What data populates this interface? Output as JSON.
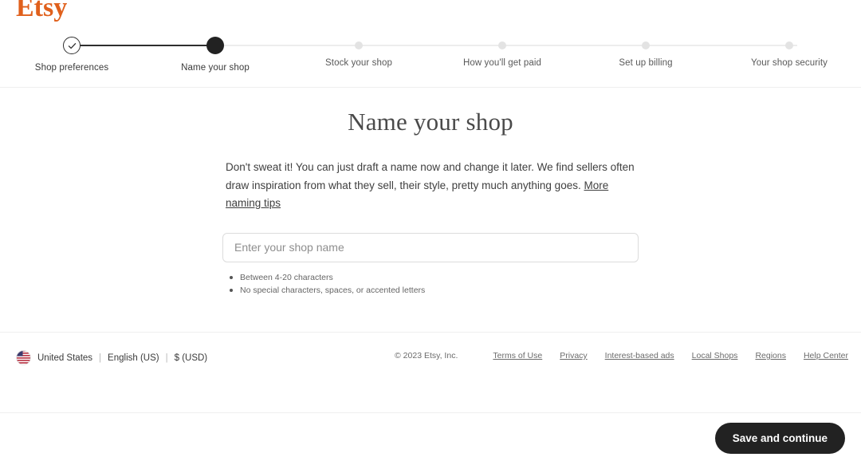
{
  "brand": {
    "logo_text": "Etsy",
    "logo_color": "#e0601c"
  },
  "stepper": {
    "steps": [
      {
        "label": "Shop preferences",
        "state": "completed",
        "icon": "check-icon"
      },
      {
        "label": "Name your shop",
        "state": "active",
        "icon": "filled-dot-icon"
      },
      {
        "label": "Stock your shop",
        "state": "upcoming",
        "icon": "dot-icon"
      },
      {
        "label": "How you'll get paid",
        "state": "upcoming",
        "icon": "dot-icon"
      },
      {
        "label": "Set up billing",
        "state": "upcoming",
        "icon": "dot-icon"
      },
      {
        "label": "Your shop security",
        "state": "upcoming",
        "icon": "dot-icon"
      }
    ]
  },
  "main": {
    "title": "Name your shop",
    "intro_text": "Don't sweat it! You can just draft a name now and change it later. We find sellers often draw inspiration from what they sell, their style, pretty much anything goes. ",
    "intro_link": "More naming tips",
    "input": {
      "value": "",
      "placeholder": "Enter your shop name"
    },
    "rules": [
      "Between 4-20 characters",
      "No special characters, spaces, or accented letters"
    ]
  },
  "footer": {
    "region_icon": "us-flag-icon",
    "country": "United States",
    "language": "English (US)",
    "currency": "$ (USD)",
    "separator": "|",
    "copyright": "© 2023 Etsy, Inc.",
    "links": [
      "Terms of Use",
      "Privacy",
      "Interest-based ads",
      "Local Shops",
      "Regions",
      "Help Center"
    ]
  },
  "action_bar": {
    "save_label": "Save and continue"
  }
}
